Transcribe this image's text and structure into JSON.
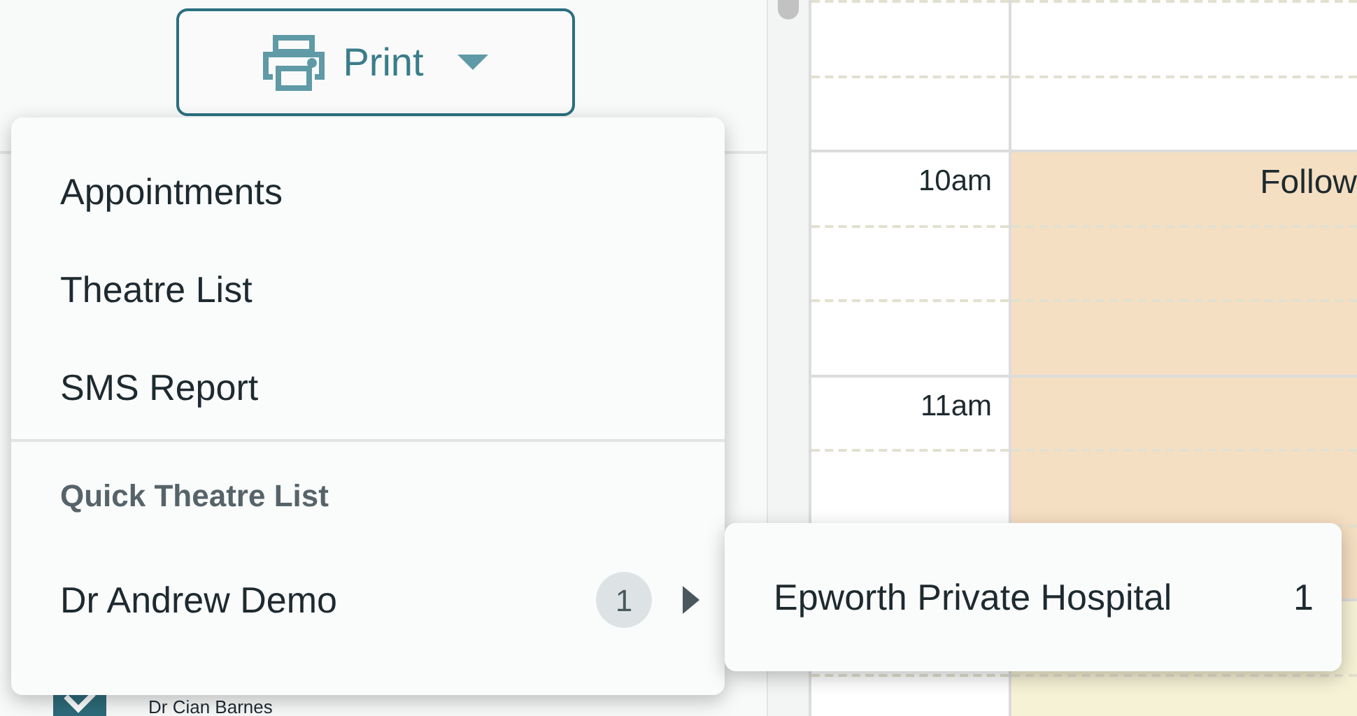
{
  "print_button": {
    "label": "Print"
  },
  "print_menu": {
    "items": [
      {
        "label": "Appointments"
      },
      {
        "label": "Theatre List"
      },
      {
        "label": "SMS Report"
      }
    ],
    "section_header": "Quick Theatre List",
    "doctors": [
      {
        "label": "Dr Andrew Demo",
        "count": "1",
        "expanded": true
      }
    ]
  },
  "submenu": {
    "items": [
      {
        "label": "Epworth Private Hospital",
        "count": "1"
      }
    ]
  },
  "doctor_filter": [
    {
      "label": "Dr Cian Barnes",
      "checked": true
    }
  ],
  "calendar": {
    "time_labels": [
      "10am",
      "11am"
    ],
    "events": [
      {
        "title": "Follow",
        "color": "#f5dfc2"
      },
      {
        "color": "#f6f2d6"
      }
    ]
  }
}
